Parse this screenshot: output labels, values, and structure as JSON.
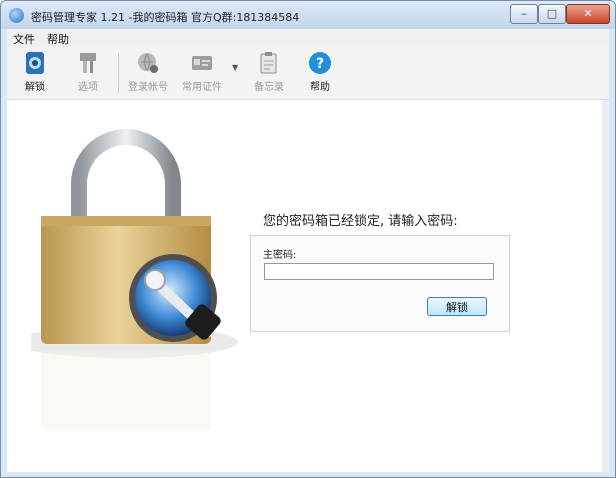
{
  "window": {
    "title": "密码管理专家 1.21 -我的密码箱 官方Q群:181384584",
    "minimize": "–",
    "maximize": "□",
    "close": "✕"
  },
  "menu": {
    "items": [
      "文件",
      "帮助"
    ]
  },
  "toolbar": {
    "items": [
      {
        "label": "解锁",
        "icon": "unlock-icon",
        "enabled": true
      },
      {
        "label": "选项",
        "icon": "options-tools-icon",
        "enabled": false
      },
      {
        "label": "登录帐号",
        "icon": "login-account-icon",
        "enabled": false
      },
      {
        "label": "常用证件",
        "icon": "id-card-icon",
        "enabled": false
      },
      {
        "label": "备忘录",
        "icon": "memo-clipboard-icon",
        "enabled": false
      },
      {
        "label": "帮助",
        "icon": "help-icon",
        "enabled": true
      }
    ]
  },
  "lock_screen": {
    "prompt": "您的密码箱已经锁定, 请输入密码:",
    "master_password_label": "主密码:",
    "password_value": "",
    "unlock_button": "解锁"
  },
  "colors": {
    "accent": "#3c7fb1",
    "help_icon": "#1e8fd8",
    "padlock_body": "#d8b46a"
  }
}
